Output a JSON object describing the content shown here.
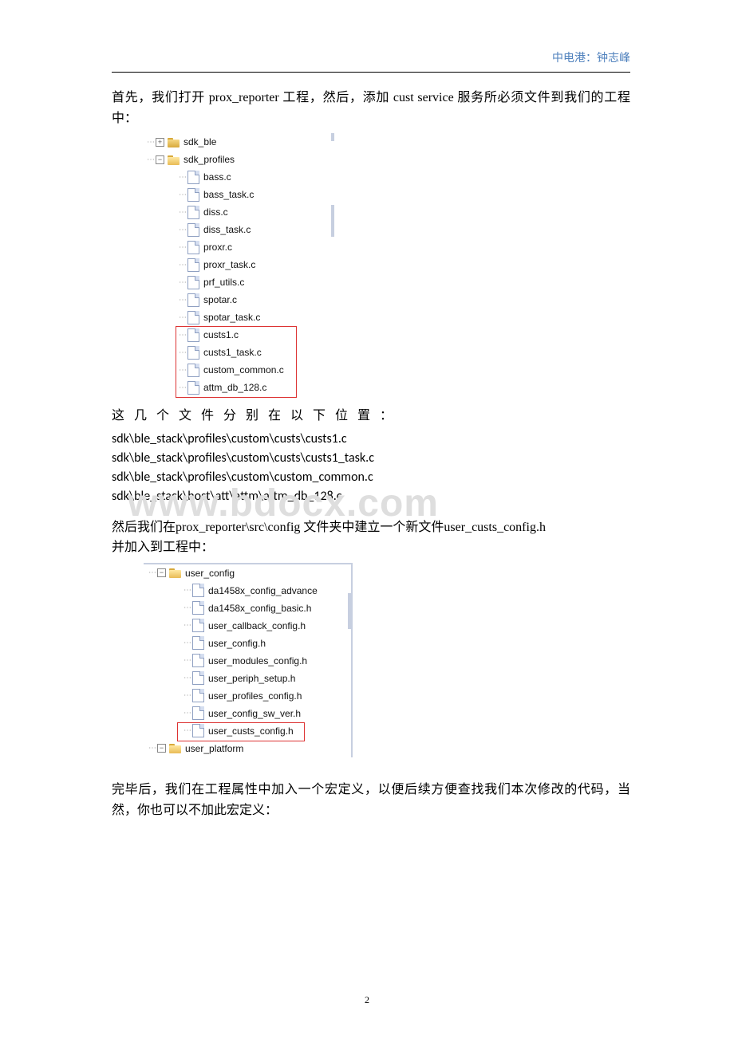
{
  "header": {
    "text": "中电港：钟志峰"
  },
  "para1_a": "首先，我们打开 ",
  "para1_b": "prox_reporter",
  "para1_c": " 工程，然后，添加 ",
  "para1_d": "cust service",
  "para1_e": " 服务所必须文件到我们的工程中：",
  "tree1": {
    "root1": "sdk_ble",
    "root2": "sdk_profiles",
    "files": [
      "bass.c",
      "bass_task.c",
      "diss.c",
      "diss_task.c",
      "proxr.c",
      "proxr_task.c",
      "prf_utils.c",
      "spotar.c",
      "spotar_task.c",
      "custs1.c",
      "custs1_task.c",
      "custom_common.c",
      "attm_db_128.c"
    ]
  },
  "para2": "这 几 个 文 件 分 别 在 以 下 位 置 ：",
  "paths": [
    "sdk\\ble_stack\\profiles\\custom\\custs\\custs1.c",
    "sdk\\ble_stack\\profiles\\custom\\custs\\custs1_task.c",
    "sdk\\ble_stack\\profiles\\custom\\custom_common.c",
    "sdk\\ble_stack\\host\\att\\attm\\attm_db_128.c"
  ],
  "para3_a": "然后我们在",
  "para3_b": "prox_reporter\\src\\config",
  "para3_c": " 文件夹中建立一个新文件",
  "para3_d": "user_custs_config.h",
  "para3_e": "并加入到工程中：",
  "tree2": {
    "root": "user_config",
    "files": [
      "da1458x_config_advance",
      "da1458x_config_basic.h",
      "user_callback_config.h",
      "user_config.h",
      "user_modules_config.h",
      "user_periph_setup.h",
      "user_profiles_config.h",
      "user_config_sw_ver.h",
      "user_custs_config.h"
    ],
    "footer": "user_platform"
  },
  "para4": "完毕后，我们在工程属性中加入一个宏定义，以便后续方便查找我们本次修改的代码，当然，你也可以不加此宏定义：",
  "watermark": "www.bdocx.com",
  "pagenum": "2"
}
